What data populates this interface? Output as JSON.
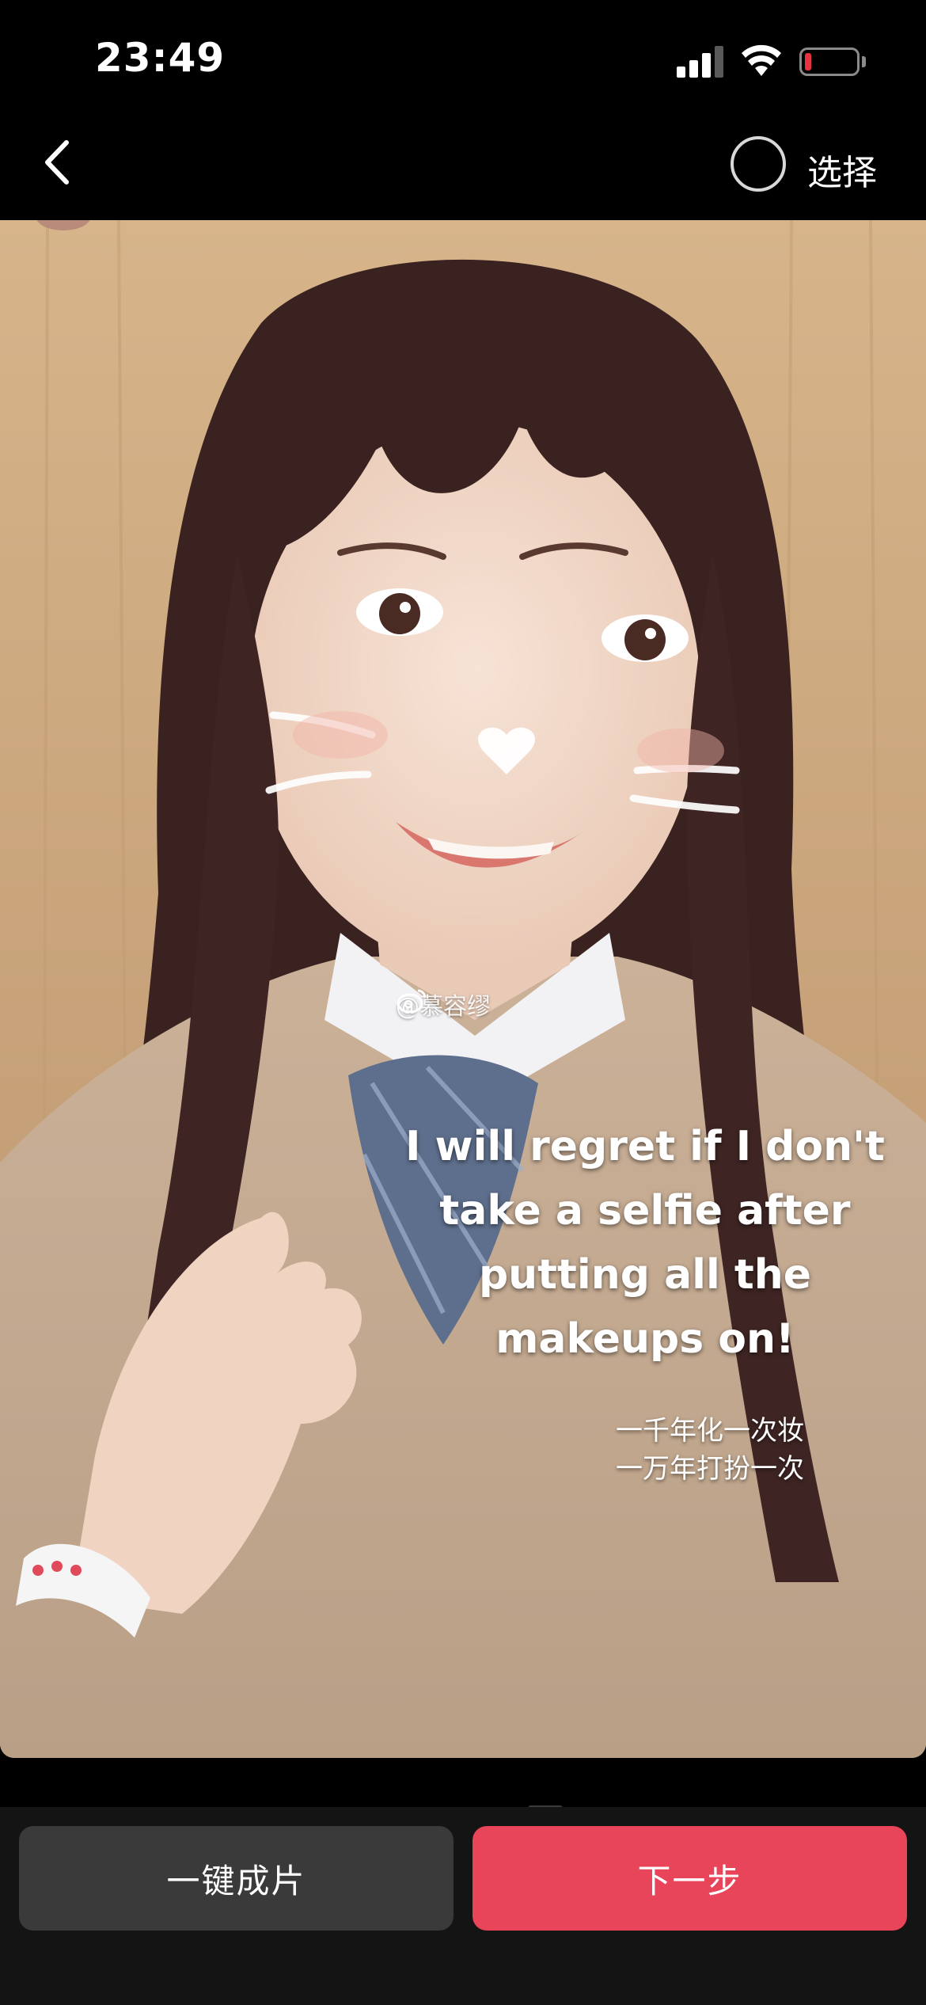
{
  "status_bar": {
    "time": "23:49",
    "battery_color": "#e5343d"
  },
  "nav": {
    "back_icon": "chevron-left-icon",
    "select_label": "选择"
  },
  "photo": {
    "watermark": "@慕容缪",
    "caption_en": "I will regret if I don't\ntake a selfie after\nputting all the\nmakeups on!",
    "caption_cn": "一千年化一次妆\n一万年打扮一次"
  },
  "actions": {
    "auto_label": "一键成片",
    "next_label": "下一步",
    "next_color": "#e8445a"
  }
}
